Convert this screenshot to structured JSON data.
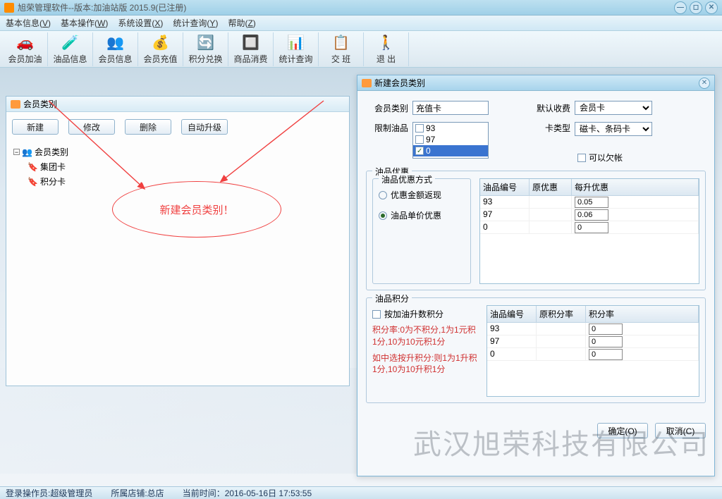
{
  "window": {
    "title": "旭荣管理软件--版本:加油站版 2015.9(已注册)"
  },
  "menubar": [
    {
      "label": "基本信息",
      "key": "V"
    },
    {
      "label": "基本操作",
      "key": "W"
    },
    {
      "label": "系统设置",
      "key": "X"
    },
    {
      "label": "统计查询",
      "key": "Y"
    },
    {
      "label": "帮助",
      "key": "Z"
    }
  ],
  "toolbar": [
    {
      "label": "会员加油",
      "icon": "🚗"
    },
    {
      "label": "油品信息",
      "icon": "🧪"
    },
    {
      "label": "会员信息",
      "icon": "👥"
    },
    {
      "label": "会员充值",
      "icon": "💰"
    },
    {
      "label": "积分兑换",
      "icon": "🔄"
    },
    {
      "label": "商品消费",
      "icon": "🔲"
    },
    {
      "label": "统计查询",
      "icon": "📊"
    },
    {
      "label": "交 班",
      "icon": "📋"
    },
    {
      "label": "退 出",
      "icon": "🚶"
    }
  ],
  "panel": {
    "title": "会员类别",
    "buttons": {
      "new": "新建",
      "edit": "修改",
      "delete": "删除",
      "auto": "自动升级"
    },
    "tree": {
      "root": "会员类别",
      "children": [
        "集团卡",
        "积分卡"
      ]
    }
  },
  "annotation": "新建会员类别！",
  "dialog": {
    "title": "新建会员类别",
    "fields": {
      "category_label": "会员类别",
      "category_value": "充值卡",
      "charge_label": "默认收费",
      "charge_value": "会员卡",
      "restrict_label": "限制油品",
      "restrict_items": [
        {
          "label": "93",
          "checked": false,
          "sel": false
        },
        {
          "label": "97",
          "checked": false,
          "sel": false
        },
        {
          "label": "0",
          "checked": true,
          "sel": true
        }
      ],
      "cardtype_label": "卡类型",
      "cardtype_value": "磁卡、条码卡",
      "credit_label": "可以欠帐"
    },
    "discount": {
      "group": "油品优惠",
      "mode_group": "油品优惠方式",
      "mode_amount": "优惠金额返现",
      "mode_unit": "油品单价优惠",
      "cols": [
        "油品编号",
        "原优惠",
        "每升优惠"
      ],
      "rows": [
        {
          "code": "93",
          "orig": "",
          "per": "0.05"
        },
        {
          "code": "97",
          "orig": "",
          "per": "0.06"
        },
        {
          "code": "0",
          "orig": "",
          "per": "0"
        }
      ]
    },
    "points": {
      "group": "油品积分",
      "chk": "按加油升数积分",
      "note1": "积分率:0为不积分,1为1元积1分,10为10元积1分",
      "note2": "如中选按升积分:则1为1升积1分,10为10升积1分",
      "cols": [
        "油品编号",
        "原积分率",
        "积分率"
      ],
      "rows": [
        {
          "code": "93",
          "orig": "",
          "rate": "0"
        },
        {
          "code": "97",
          "orig": "",
          "rate": "0"
        },
        {
          "code": "0",
          "orig": "",
          "rate": "0"
        }
      ]
    },
    "ok": "确定(O)",
    "cancel": "取消(C)"
  },
  "status": {
    "user": "登录操作员:超级管理员",
    "store": "所属店铺:总店",
    "time": "当前时间：2016-05-16日 17:53:55"
  },
  "watermark": "武汉旭荣科技有限公司"
}
